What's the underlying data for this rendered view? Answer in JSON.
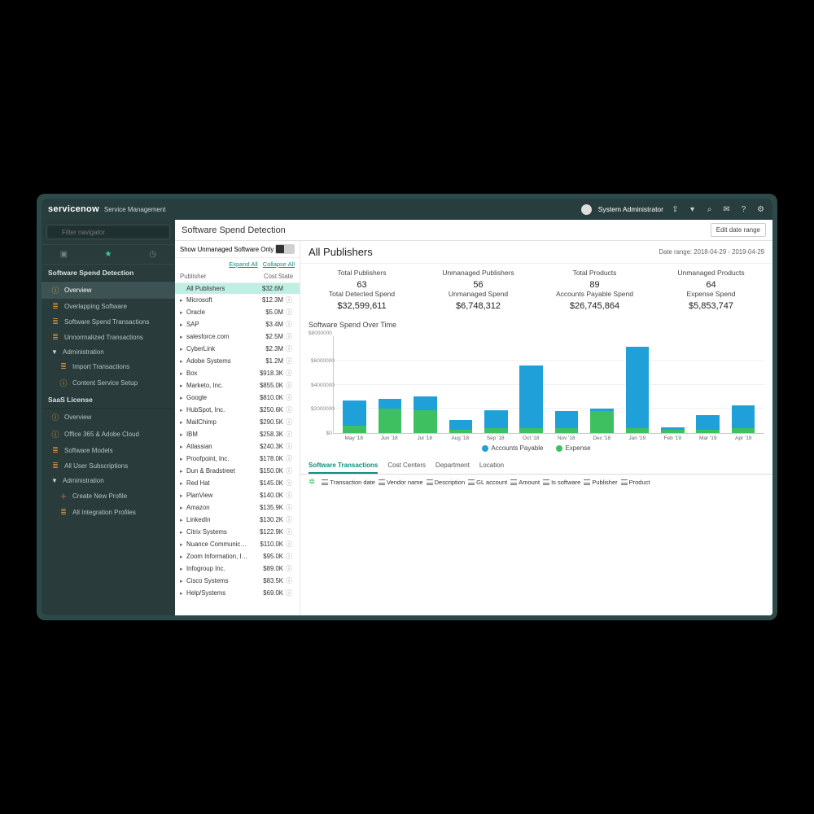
{
  "brand": {
    "logo": "servicenow",
    "sub": "Service Management"
  },
  "topbar": {
    "user": "System Administrator"
  },
  "filter": {
    "placeholder": "Filter navigator"
  },
  "sidebar": {
    "section1": "Software Spend Detection",
    "items1": [
      {
        "label": "Overview",
        "active": true,
        "iconCls": "info"
      },
      {
        "label": "Overlapping Software",
        "iconCls": "or"
      },
      {
        "label": "Software Spend Transactions",
        "iconCls": "or"
      },
      {
        "label": "Unnormalized Transactions",
        "iconCls": "or"
      },
      {
        "label": "Administration",
        "caret": true
      },
      {
        "label": "Import Transactions",
        "sub": true,
        "iconCls": "or"
      },
      {
        "label": "Content Service Setup",
        "sub": true,
        "iconCls": "info"
      }
    ],
    "section2": "SaaS License",
    "items2": [
      {
        "label": "Overview",
        "iconCls": "info"
      },
      {
        "label": "Office 365 & Adobe Cloud",
        "iconCls": "info"
      },
      {
        "label": "Software Models",
        "iconCls": "or"
      },
      {
        "label": "All User Subscriptions",
        "iconCls": "or"
      },
      {
        "label": "Administration",
        "caret": true
      },
      {
        "label": "Create New Profile",
        "sub": true,
        "iconCls": "plus"
      },
      {
        "label": "All Integration Profiles",
        "sub": true,
        "iconCls": "or"
      }
    ]
  },
  "page": {
    "title": "Software Spend Detection",
    "editBtn": "Edit date range"
  },
  "pubPanel": {
    "unmanagedOnly": "Show Unmanaged Software Only",
    "expand": "Expand All",
    "collapse": "Collapse All",
    "headPublisher": "Publisher",
    "headCost": "Cost",
    "headState": "State",
    "rows": [
      {
        "name": "All Publishers",
        "cost": "$32.6M",
        "sel": true,
        "noExp": true
      },
      {
        "name": "Microsoft",
        "cost": "$12.3M"
      },
      {
        "name": "Oracle",
        "cost": "$5.0M"
      },
      {
        "name": "SAP",
        "cost": "$3.4M"
      },
      {
        "name": "salesforce.com",
        "cost": "$2.5M"
      },
      {
        "name": "CyberLink",
        "cost": "$2.3M"
      },
      {
        "name": "Adobe Systems",
        "cost": "$1.2M"
      },
      {
        "name": "Box",
        "cost": "$918.3K"
      },
      {
        "name": "Marketo, Inc.",
        "cost": "$855.0K"
      },
      {
        "name": "Google",
        "cost": "$810.0K"
      },
      {
        "name": "HubSpot, Inc.",
        "cost": "$250.6K"
      },
      {
        "name": "MailChimp",
        "cost": "$290.5K"
      },
      {
        "name": "IBM",
        "cost": "$258.3K"
      },
      {
        "name": "Atlassian",
        "cost": "$240.3K"
      },
      {
        "name": "Proofpoint, Inc.",
        "cost": "$178.0K"
      },
      {
        "name": "Dun & Bradstreet",
        "cost": "$150.0K"
      },
      {
        "name": "Red Hat",
        "cost": "$145.0K"
      },
      {
        "name": "PlanView",
        "cost": "$140.0K"
      },
      {
        "name": "Amazon",
        "cost": "$135.9K"
      },
      {
        "name": "LinkedIn",
        "cost": "$130.2K"
      },
      {
        "name": "Citrix Systems",
        "cost": "$122.9K"
      },
      {
        "name": "Nuance Communications",
        "cost": "$110.0K"
      },
      {
        "name": "Zoom Information, Inc.",
        "cost": "$95.0K"
      },
      {
        "name": "Infogroup Inc.",
        "cost": "$89.0K"
      },
      {
        "name": "Cisco Systems",
        "cost": "$83.5K"
      },
      {
        "name": "Help/Systems",
        "cost": "$69.0K"
      }
    ]
  },
  "main": {
    "title": "All Publishers",
    "dateRange": "Date range: 2018-04-29 - 2019-04-29",
    "metrics": [
      {
        "label": "Total Publishers",
        "val": "63"
      },
      {
        "label": "Unmanaged Publishers",
        "val": "56"
      },
      {
        "label": "Total Products",
        "val": "89"
      },
      {
        "label": "Unmanaged Products",
        "val": "64"
      },
      {
        "label": "Total Detected Spend",
        "val": "$32,599,611"
      },
      {
        "label": "Unmanaged Spend",
        "val": "$6,748,312"
      },
      {
        "label": "Accounts Payable Spend",
        "val": "$26,745,864"
      },
      {
        "label": "Expense Spend",
        "val": "$5,853,747"
      }
    ],
    "chartTitle": "Software Spend Over Time",
    "legend": {
      "ap": "Accounts Payable",
      "ex": "Expense"
    },
    "tabs": [
      "Software Transactions",
      "Cost Centers",
      "Department",
      "Location"
    ],
    "columns": [
      "Transaction date",
      "Vendor name",
      "Description",
      "GL account",
      "Amount",
      "Is software",
      "Publisher",
      "Product"
    ]
  },
  "chart_data": {
    "type": "bar",
    "title": "Software Spend Over Time",
    "ylabel": "",
    "xlabel": "",
    "ylim": [
      0,
      8000000
    ],
    "yticks": [
      0,
      2000000,
      4000000,
      6000000,
      8000000
    ],
    "categories": [
      "May '18",
      "Jun '18",
      "Jul '18",
      "Aug '18",
      "Sep '18",
      "Oct '18",
      "Nov '18",
      "Dec '18",
      "Jan '19",
      "Feb '19",
      "Mar '19",
      "Apr '19"
    ],
    "series": [
      {
        "name": "Expense",
        "color": "#3fc060",
        "values": [
          600000,
          2000000,
          1900000,
          300000,
          400000,
          400000,
          400000,
          1800000,
          400000,
          300000,
          300000,
          400000
        ]
      },
      {
        "name": "Accounts Payable",
        "color": "#20a0d8",
        "values": [
          2100000,
          800000,
          1100000,
          800000,
          1500000,
          5200000,
          1400000,
          200000,
          6700000,
          200000,
          1200000,
          1900000
        ]
      }
    ]
  }
}
